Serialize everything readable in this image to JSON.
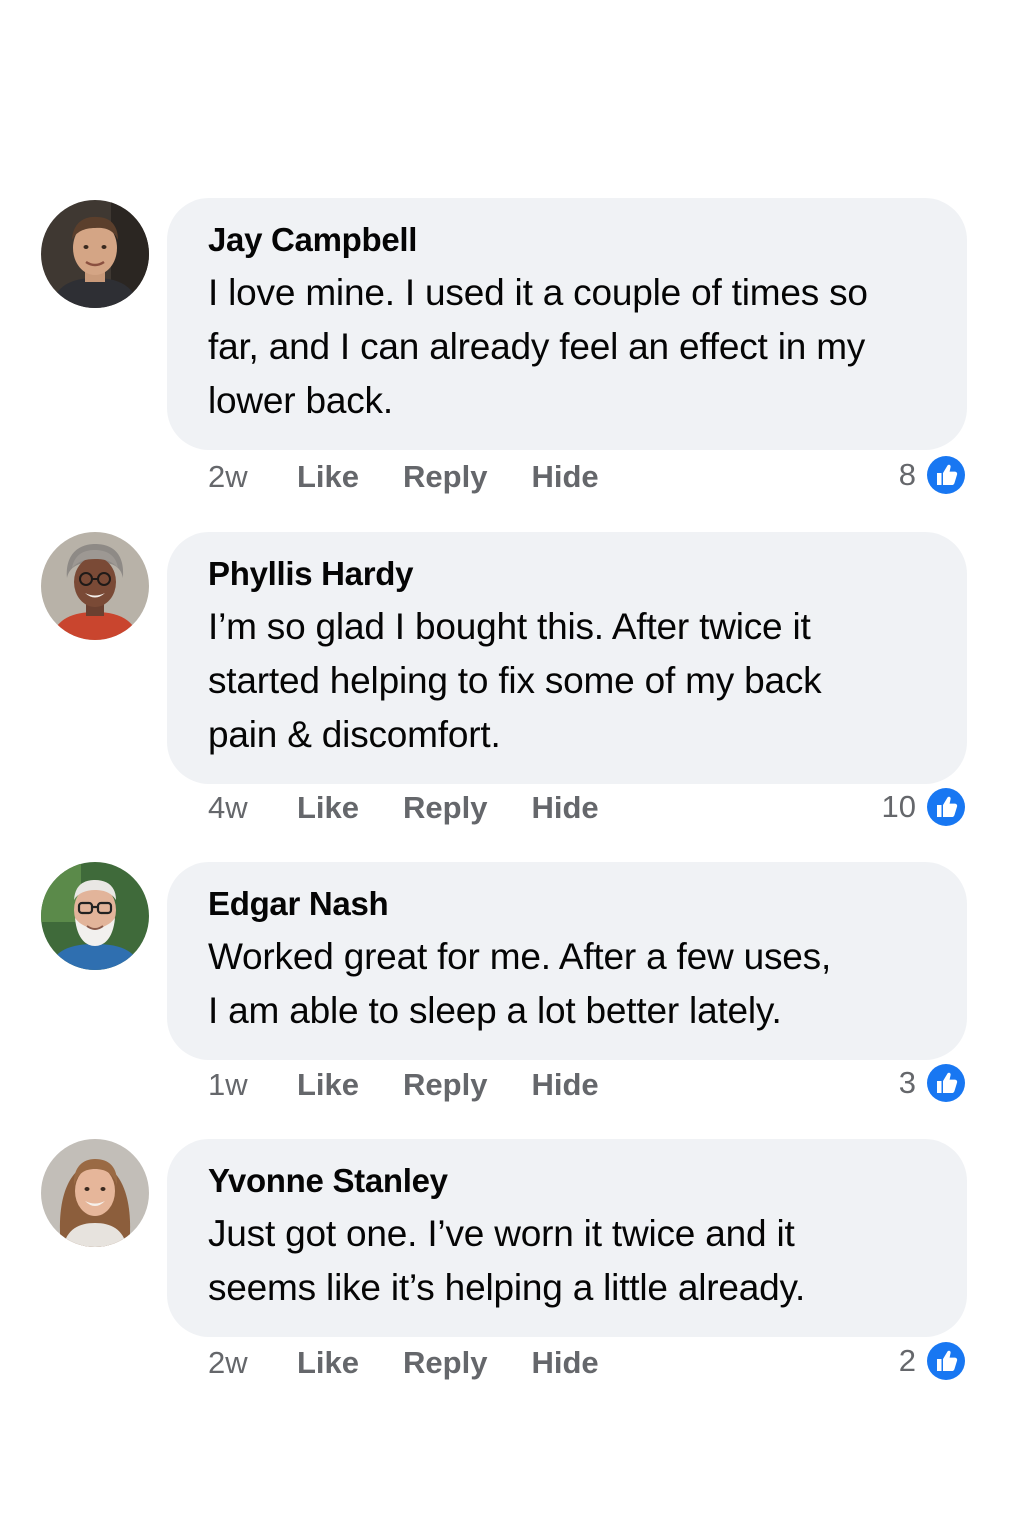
{
  "colors": {
    "bubble_bg": "#f0f2f5",
    "meta_text": "#65676b",
    "like_blue": "#1877f2"
  },
  "icons": {
    "like": "thumbs-up-icon"
  },
  "comments": [
    {
      "author": "Jay Campbell",
      "lines": [
        "I love mine. I used it a couple of times so",
        "far, and I can already feel an effect in my",
        "lower back."
      ],
      "age": "2w",
      "like_label": "Like",
      "reply_label": "Reply",
      "hide_label": "Hide",
      "reaction_count": "8"
    },
    {
      "author": "Phyllis Hardy",
      "lines": [
        "I’m so glad I bought this. After twice it",
        "started helping to fix some of my back",
        "pain & discomfort."
      ],
      "age": "4w",
      "like_label": "Like",
      "reply_label": "Reply",
      "hide_label": "Hide",
      "reaction_count": "10"
    },
    {
      "author": "Edgar Nash",
      "lines": [
        "Worked great for me. After a few uses,",
        "I am able to sleep a lot better lately."
      ],
      "age": "1w",
      "like_label": "Like",
      "reply_label": "Reply",
      "hide_label": "Hide",
      "reaction_count": "3"
    },
    {
      "author": "Yvonne Stanley",
      "lines": [
        "Just got one. I’ve worn it twice and it",
        "seems like it’s helping a little already."
      ],
      "age": "2w",
      "like_label": "Like",
      "reply_label": "Reply",
      "hide_label": "Hide",
      "reaction_count": "2"
    }
  ]
}
